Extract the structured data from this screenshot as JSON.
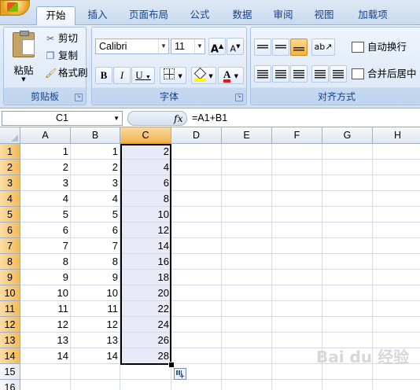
{
  "ribbon": {
    "tabs": [
      {
        "label": "开始",
        "active": true
      },
      {
        "label": "插入"
      },
      {
        "label": "页面布局"
      },
      {
        "label": "公式"
      },
      {
        "label": "数据"
      },
      {
        "label": "审阅"
      },
      {
        "label": "视图"
      },
      {
        "label": "加载项"
      }
    ],
    "clipboard": {
      "group_label": "剪贴板",
      "paste": "粘贴",
      "cut": "剪切",
      "copy": "复制",
      "format_painter": "格式刷"
    },
    "font": {
      "group_label": "字体",
      "font_name": "Calibri",
      "font_size": "11",
      "bold": "B",
      "italic": "I",
      "underline": "U",
      "grow": "A",
      "shrink": "A",
      "font_color_glyph": "A",
      "font_color": "#e01b1b",
      "fill_color": "#ffff00"
    },
    "alignment": {
      "group_label": "对齐方式",
      "wrap_text": "自动换行",
      "merge_center": "合并后居中"
    }
  },
  "formula_bar": {
    "name_box": "C1",
    "fx": "fx",
    "formula": "=A1+B1"
  },
  "sheet": {
    "columns": [
      "A",
      "B",
      "C",
      "D",
      "E",
      "F",
      "G",
      "H"
    ],
    "selected_column": "C",
    "rows": [
      {
        "n": "1",
        "a": "1",
        "b": "1",
        "c": "2"
      },
      {
        "n": "2",
        "a": "2",
        "b": "2",
        "c": "4"
      },
      {
        "n": "3",
        "a": "3",
        "b": "3",
        "c": "6"
      },
      {
        "n": "4",
        "a": "4",
        "b": "4",
        "c": "8"
      },
      {
        "n": "5",
        "a": "5",
        "b": "5",
        "c": "10"
      },
      {
        "n": "6",
        "a": "6",
        "b": "6",
        "c": "12"
      },
      {
        "n": "7",
        "a": "7",
        "b": "7",
        "c": "14"
      },
      {
        "n": "8",
        "a": "8",
        "b": "8",
        "c": "16"
      },
      {
        "n": "9",
        "a": "9",
        "b": "9",
        "c": "18"
      },
      {
        "n": "10",
        "a": "10",
        "b": "10",
        "c": "20"
      },
      {
        "n": "11",
        "a": "11",
        "b": "11",
        "c": "22"
      },
      {
        "n": "12",
        "a": "12",
        "b": "12",
        "c": "24"
      },
      {
        "n": "13",
        "a": "13",
        "b": "13",
        "c": "26"
      },
      {
        "n": "14",
        "a": "14",
        "b": "14",
        "c": "28"
      },
      {
        "n": "15",
        "a": "",
        "b": "",
        "c": ""
      },
      {
        "n": "16",
        "a": "",
        "b": "",
        "c": ""
      }
    ],
    "selection_bg": "#e8ebf7"
  },
  "watermark": "Bai du 经验"
}
